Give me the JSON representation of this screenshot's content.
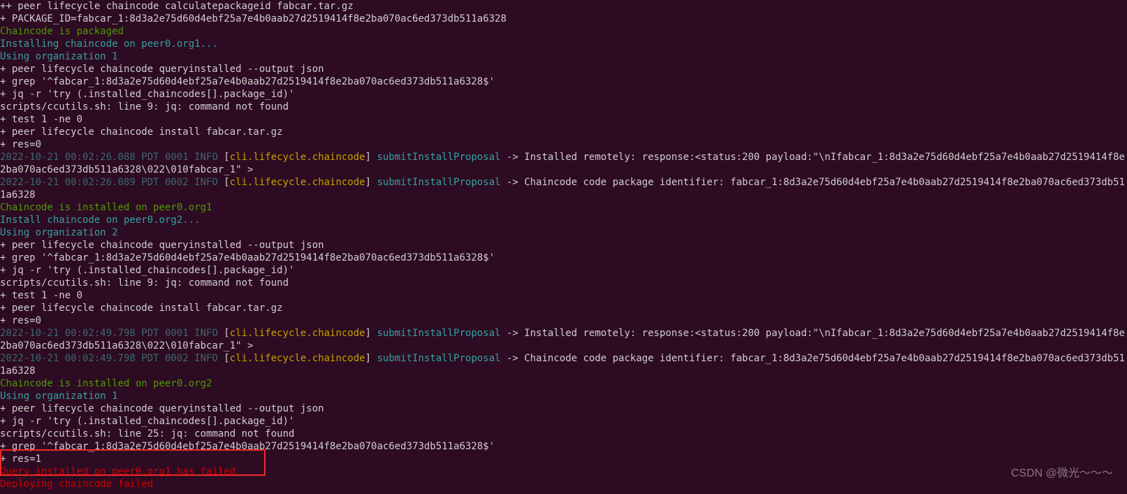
{
  "lines": [
    {
      "spans": [
        {
          "cls": "c-plain",
          "text": "++ peer lifecycle chaincode calculatepackageid fabcar.tar.gz"
        }
      ]
    },
    {
      "spans": [
        {
          "cls": "c-plain",
          "text": "+ PACKAGE_ID=fabcar_1:8d3a2e75d60d4ebf25a7e4b0aab27d2519414f8e2ba070ac6ed373db511a6328"
        }
      ]
    },
    {
      "spans": [
        {
          "cls": "c-green",
          "text": "Chaincode is packaged"
        }
      ]
    },
    {
      "spans": [
        {
          "cls": "c-cyan",
          "text": "Installing chaincode on peer0.org1..."
        }
      ]
    },
    {
      "spans": [
        {
          "cls": "c-cyan",
          "text": "Using organization 1"
        }
      ]
    },
    {
      "spans": [
        {
          "cls": "c-plain",
          "text": "+ peer lifecycle chaincode queryinstalled --output json"
        }
      ]
    },
    {
      "spans": [
        {
          "cls": "c-plain",
          "text": "+ grep '^fabcar_1:8d3a2e75d60d4ebf25a7e4b0aab27d2519414f8e2ba070ac6ed373db511a6328$'"
        }
      ]
    },
    {
      "spans": [
        {
          "cls": "c-plain",
          "text": "+ jq -r 'try (.installed_chaincodes[].package_id)'"
        }
      ]
    },
    {
      "spans": [
        {
          "cls": "c-plain",
          "text": "scripts/ccutils.sh: line 9: jq: command not found"
        }
      ]
    },
    {
      "spans": [
        {
          "cls": "c-plain",
          "text": "+ test 1 -ne 0"
        }
      ]
    },
    {
      "spans": [
        {
          "cls": "c-plain",
          "text": "+ peer lifecycle chaincode install fabcar.tar.gz"
        }
      ]
    },
    {
      "spans": [
        {
          "cls": "c-plain",
          "text": "+ res=0"
        }
      ]
    },
    {
      "spans": [
        {
          "cls": "c-darkcyan",
          "text": "2022-10-21 00:02:26.088 PDT 0001 INFO"
        },
        {
          "cls": "c-plain",
          "text": " ["
        },
        {
          "cls": "c-yellow",
          "text": "cli.lifecycle.chaincode"
        },
        {
          "cls": "c-plain",
          "text": "] "
        },
        {
          "cls": "c-cyan",
          "text": "submitInstallProposal"
        },
        {
          "cls": "c-plain",
          "text": " -> Installed remotely: response:<status:200 payload:\"\\nIfabcar_1:8d3a2e75d60d4ebf25a7e4b0aab27d2519414f8e2ba070ac6ed373db511a6328\\022\\010fabcar_1\" >"
        }
      ]
    },
    {
      "spans": [
        {
          "cls": "c-darkcyan",
          "text": "2022-10-21 00:02:26.089 PDT 0002 INFO"
        },
        {
          "cls": "c-plain",
          "text": " ["
        },
        {
          "cls": "c-yellow",
          "text": "cli.lifecycle.chaincode"
        },
        {
          "cls": "c-plain",
          "text": "] "
        },
        {
          "cls": "c-cyan",
          "text": "submitInstallProposal"
        },
        {
          "cls": "c-plain",
          "text": " -> Chaincode code package identifier: fabcar_1:8d3a2e75d60d4ebf25a7e4b0aab27d2519414f8e2ba070ac6ed373db511a6328"
        }
      ]
    },
    {
      "spans": [
        {
          "cls": "c-green",
          "text": "Chaincode is installed on peer0.org1"
        }
      ]
    },
    {
      "spans": [
        {
          "cls": "c-cyan",
          "text": "Install chaincode on peer0.org2..."
        }
      ]
    },
    {
      "spans": [
        {
          "cls": "c-cyan",
          "text": "Using organization 2"
        }
      ]
    },
    {
      "spans": [
        {
          "cls": "c-plain",
          "text": "+ peer lifecycle chaincode queryinstalled --output json"
        }
      ]
    },
    {
      "spans": [
        {
          "cls": "c-plain",
          "text": "+ grep '^fabcar_1:8d3a2e75d60d4ebf25a7e4b0aab27d2519414f8e2ba070ac6ed373db511a6328$'"
        }
      ]
    },
    {
      "spans": [
        {
          "cls": "c-plain",
          "text": "+ jq -r 'try (.installed_chaincodes[].package_id)'"
        }
      ]
    },
    {
      "spans": [
        {
          "cls": "c-plain",
          "text": "scripts/ccutils.sh: line 9: jq: command not found"
        }
      ]
    },
    {
      "spans": [
        {
          "cls": "c-plain",
          "text": "+ test 1 -ne 0"
        }
      ]
    },
    {
      "spans": [
        {
          "cls": "c-plain",
          "text": "+ peer lifecycle chaincode install fabcar.tar.gz"
        }
      ]
    },
    {
      "spans": [
        {
          "cls": "c-plain",
          "text": "+ res=0"
        }
      ]
    },
    {
      "spans": [
        {
          "cls": "c-darkcyan",
          "text": "2022-10-21 00:02:49.798 PDT 0001 INFO"
        },
        {
          "cls": "c-plain",
          "text": " ["
        },
        {
          "cls": "c-yellow",
          "text": "cli.lifecycle.chaincode"
        },
        {
          "cls": "c-plain",
          "text": "] "
        },
        {
          "cls": "c-cyan",
          "text": "submitInstallProposal"
        },
        {
          "cls": "c-plain",
          "text": " -> Installed remotely: response:<status:200 payload:\"\\nIfabcar_1:8d3a2e75d60d4ebf25a7e4b0aab27d2519414f8e2ba070ac6ed373db511a6328\\022\\010fabcar_1\" >"
        }
      ]
    },
    {
      "spans": [
        {
          "cls": "c-darkcyan",
          "text": "2022-10-21 00:02:49.798 PDT 0002 INFO"
        },
        {
          "cls": "c-plain",
          "text": " ["
        },
        {
          "cls": "c-yellow",
          "text": "cli.lifecycle.chaincode"
        },
        {
          "cls": "c-plain",
          "text": "] "
        },
        {
          "cls": "c-cyan",
          "text": "submitInstallProposal"
        },
        {
          "cls": "c-plain",
          "text": " -> Chaincode code package identifier: fabcar_1:8d3a2e75d60d4ebf25a7e4b0aab27d2519414f8e2ba070ac6ed373db511a6328"
        }
      ]
    },
    {
      "spans": [
        {
          "cls": "c-green",
          "text": "Chaincode is installed on peer0.org2"
        }
      ]
    },
    {
      "spans": [
        {
          "cls": "c-cyan",
          "text": "Using organization 1"
        }
      ]
    },
    {
      "spans": [
        {
          "cls": "c-plain",
          "text": "+ peer lifecycle chaincode queryinstalled --output json"
        }
      ]
    },
    {
      "spans": [
        {
          "cls": "c-plain",
          "text": "+ jq -r 'try (.installed_chaincodes[].package_id)'"
        }
      ]
    },
    {
      "spans": [
        {
          "cls": "c-plain",
          "text": "scripts/ccutils.sh: line 25: jq: command not found"
        }
      ]
    },
    {
      "spans": [
        {
          "cls": "c-plain",
          "text": "+ grep '^fabcar_1:8d3a2e75d60d4ebf25a7e4b0aab27d2519414f8e2ba070ac6ed373db511a6328$'"
        }
      ]
    },
    {
      "spans": [
        {
          "cls": "c-plain",
          "text": "+ res=1"
        }
      ]
    },
    {
      "spans": [
        {
          "cls": "c-red",
          "text": "Query installed on peer0.org1 has failed"
        }
      ]
    },
    {
      "spans": [
        {
          "cls": "c-red",
          "text": "Deploying chaincode failed"
        }
      ]
    }
  ],
  "watermark": "CSDN @微光～～～"
}
